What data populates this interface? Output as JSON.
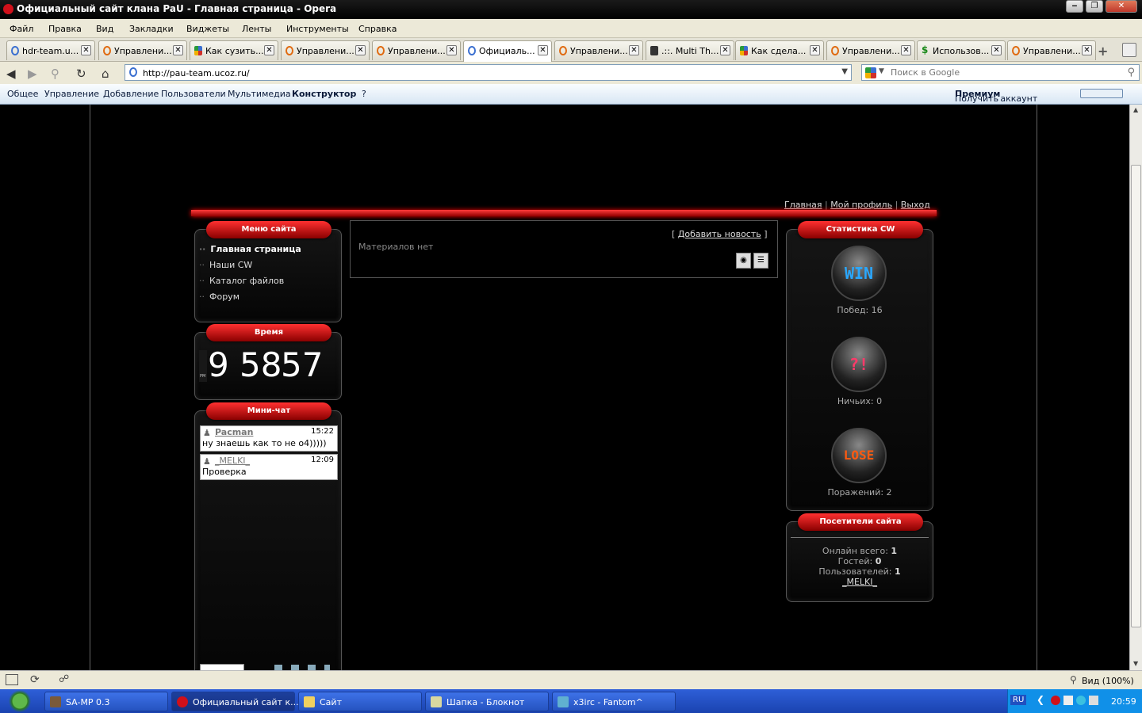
{
  "window": {
    "title": "Официальный сайт клана PaU - Главная страница - Opera",
    "buttons": [
      "‒",
      "❐",
      "✕"
    ]
  },
  "menu": [
    "Файл",
    "Правка",
    "Вид",
    "Закладки",
    "Виджеты",
    "Ленты",
    "Инструменты",
    "Справка"
  ],
  "tabs": [
    {
      "label": "hdr-team.u...",
      "icon": "blue"
    },
    {
      "label": "Управлени...",
      "icon": "orange"
    },
    {
      "label": "Как сузить...",
      "icon": "goog"
    },
    {
      "label": "Управлени...",
      "icon": "orange"
    },
    {
      "label": "Управлени...",
      "icon": "orange"
    },
    {
      "label": "Официаль...",
      "icon": "blue",
      "active": true
    },
    {
      "label": "Управлени...",
      "icon": "orange"
    },
    {
      "label": ".::. Multi Th...",
      "icon": "dark"
    },
    {
      "label": "Как сдела...",
      "icon": "goog"
    },
    {
      "label": "Управлени...",
      "icon": "orange"
    },
    {
      "label": "Использов...",
      "icon": "dollar"
    },
    {
      "label": "Управлени...",
      "icon": "orange"
    }
  ],
  "tab_close": "✕",
  "address": {
    "url": "http://pau-team.ucoz.ru/"
  },
  "search": {
    "placeholder": "Поиск в Google"
  },
  "adminbar": {
    "items": [
      "Общее",
      "Управление",
      "Добавление",
      "Пользователи",
      "Мультимедиа",
      "Конструктор",
      "?"
    ],
    "premium_prefix": "Получить",
    "premium_bold": "Премиум",
    "premium_suffix": "аккаунт"
  },
  "site": {
    "topnav": [
      "Главная",
      "Мой профиль",
      "Выход"
    ],
    "sep": "|",
    "menu_title": "Меню сайта",
    "menu_items": [
      "Главная страница",
      "Наши CW",
      "Каталог файлов",
      "Форум"
    ],
    "time_title": "Время",
    "clock": {
      "ampm": "PM",
      "hour": "9",
      "minutes": "58",
      "seconds": "57"
    },
    "chat_title": "Мини-чат",
    "chat": [
      {
        "user": "Pacman",
        "time": "15:22",
        "text": "ну знаешь как то не о4)))))"
      },
      {
        "user": "_MELKI_",
        "time": "12:09",
        "text": "Проверка"
      }
    ],
    "add_news": "Добавить новость",
    "bracket_l": "[",
    "bracket_r": "]",
    "no_materials": "Материалов нет",
    "stats_title": "Статистика CW",
    "stats": [
      {
        "badge": "WIN",
        "label": "Побед: 16",
        "color": "#2aa8ff"
      },
      {
        "badge": "?!",
        "label": "Ничьих: 0",
        "color": "#ff3a6a"
      },
      {
        "badge": "LOSE",
        "label": "Поражений: 2",
        "color": "#ff5a10"
      }
    ],
    "visitors_title": "Посетители сайта",
    "online_label": "Онлайн всего:",
    "online_value": "1",
    "guests_label": "Гостей:",
    "guests_value": "0",
    "users_label": "Пользователей:",
    "users_value": "1",
    "online_user": "_MELKI_"
  },
  "statusbar": {
    "zoom": "Вид (100%)"
  },
  "taskbar": {
    "tasks": [
      "SA-MP 0.3",
      "Официальный сайт к...",
      "Сайт",
      "Шапка - Блокнот",
      "x3irc - Fantom^"
    ],
    "lang": "RU",
    "clock": "20:59"
  }
}
